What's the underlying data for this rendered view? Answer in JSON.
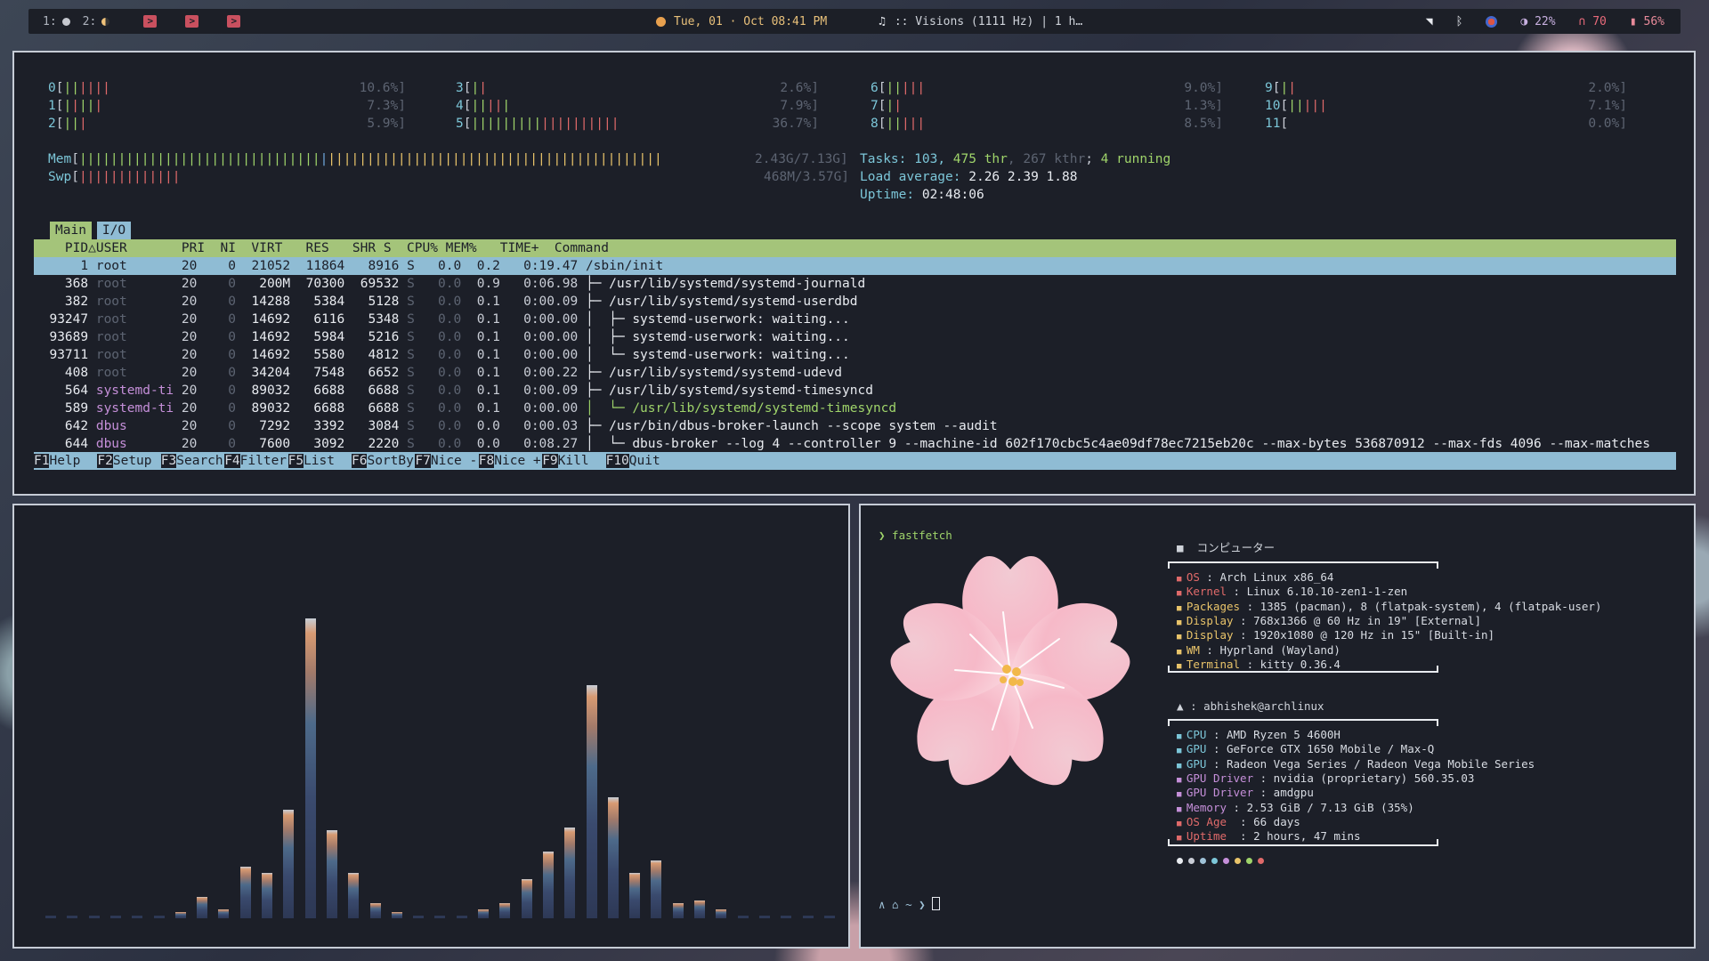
{
  "topbar": {
    "workspaces": [
      "1:",
      "2:"
    ],
    "datetime": "Tue, 01 · Oct  08:41 PM",
    "media": ":: Visions (1111 Hz) | 1 h…",
    "brightness": "22%",
    "volume": "70",
    "battery": "56%"
  },
  "htop": {
    "cpus_left": [
      {
        "id": "0",
        "pct": "10.6%]"
      },
      {
        "id": "1",
        "pct": "7.3%]"
      },
      {
        "id": "2",
        "pct": "5.9%]"
      }
    ],
    "cpus_mid": [
      {
        "id": "3",
        "pct": "2.6%]"
      },
      {
        "id": "4",
        "pct": "7.9%]"
      },
      {
        "id": "5",
        "pct": "36.7%]"
      }
    ],
    "cpus_r1": [
      {
        "id": "6",
        "pct": "9.0%]"
      },
      {
        "id": "7",
        "pct": "1.3%]"
      },
      {
        "id": "8",
        "pct": "8.5%]"
      }
    ],
    "cpus_r2": [
      {
        "id": "9",
        "pct": "2.0%]"
      },
      {
        "id": "10",
        "pct": "7.1%]"
      },
      {
        "id": "11",
        "pct": "0.0%]"
      }
    ],
    "mem_label": "Mem",
    "mem_value": "2.43G/7.13G]",
    "swp_label": "Swp",
    "swp_value": "468M/3.57G]",
    "tasks_label": "Tasks:",
    "tasks_count": "103,",
    "thr_count": "475 thr",
    "kthr": ", 267 kthr",
    "running": "4 running",
    "load_label": "Load average:",
    "load_values": "2.26 2.39 1.88",
    "uptime_label": "Uptime:",
    "uptime_value": "02:48:06",
    "tabs": [
      "Main",
      "I/O"
    ],
    "header": "    PID△USER       PRI  NI  VIRT   RES   SHR S  CPU% MEM%   TIME+  Command",
    "rows": [
      {
        "pid": "      1",
        "user": "root      ",
        "pri": "20",
        "ni": "   0",
        "virt": " 21052",
        "res": " 11864",
        "shr": "  8916",
        "s": "S",
        "cpu": "  0.0",
        "mem": " 0.2",
        "time": "  0:19.47",
        "cmd": "/sbin/init"
      },
      {
        "pid": "    368",
        "user": "root      ",
        "pri": "20",
        "ni": "   0",
        "virt": "  200M",
        "res": " 70300",
        "shr": " 69532",
        "s": "S",
        "cpu": "  0.0",
        "mem": " 0.9",
        "time": "  0:06.98",
        "cmd": "├─ /usr/lib/systemd/systemd-journald"
      },
      {
        "pid": "    382",
        "user": "root      ",
        "pri": "20",
        "ni": "   0",
        "virt": " 14288",
        "res": "  5384",
        "shr": "  5128",
        "s": "S",
        "cpu": "  0.0",
        "mem": " 0.1",
        "time": "  0:00.09",
        "cmd": "├─ /usr/lib/systemd/systemd-userdbd"
      },
      {
        "pid": "  93247",
        "user": "root      ",
        "pri": "20",
        "ni": "   0",
        "virt": " 14692",
        "res": "  6116",
        "shr": "  5348",
        "s": "S",
        "cpu": "  0.0",
        "mem": " 0.1",
        "time": "  0:00.00",
        "cmd": "│  ├─ systemd-userwork: waiting..."
      },
      {
        "pid": "  93689",
        "user": "root      ",
        "pri": "20",
        "ni": "   0",
        "virt": " 14692",
        "res": "  5984",
        "shr": "  5216",
        "s": "S",
        "cpu": "  0.0",
        "mem": " 0.1",
        "time": "  0:00.00",
        "cmd": "│  ├─ systemd-userwork: waiting..."
      },
      {
        "pid": "  93711",
        "user": "root      ",
        "pri": "20",
        "ni": "   0",
        "virt": " 14692",
        "res": "  5580",
        "shr": "  4812",
        "s": "S",
        "cpu": "  0.0",
        "mem": " 0.1",
        "time": "  0:00.00",
        "cmd": "│  └─ systemd-userwork: waiting..."
      },
      {
        "pid": "    408",
        "user": "root      ",
        "pri": "20",
        "ni": "   0",
        "virt": " 34204",
        "res": "  7548",
        "shr": "  6652",
        "s": "S",
        "cpu": "  0.0",
        "mem": " 0.1",
        "time": "  0:00.22",
        "cmd": "├─ /usr/lib/systemd/systemd-udevd"
      },
      {
        "pid": "    564",
        "user": "systemd-ti",
        "pri": "20",
        "ni": "   0",
        "virt": " 89032",
        "res": "  6688",
        "shr": "  6688",
        "s": "S",
        "cpu": "  0.0",
        "mem": " 0.1",
        "time": "  0:00.09",
        "cmd": "├─ /usr/lib/systemd/systemd-timesyncd"
      },
      {
        "pid": "    589",
        "user": "systemd-ti",
        "pri": "20",
        "ni": "   0",
        "virt": " 89032",
        "res": "  6688",
        "shr": "  6688",
        "s": "S",
        "cpu": "  0.0",
        "mem": " 0.1",
        "time": "  0:00.00",
        "cmd": "│  └─ /usr/lib/systemd/systemd-timesyncd"
      },
      {
        "pid": "    642",
        "user": "dbus      ",
        "pri": "20",
        "ni": "   0",
        "virt": "  7292",
        "res": "  3392",
        "shr": "  3084",
        "s": "S",
        "cpu": "  0.0",
        "mem": " 0.0",
        "time": "  0:00.03",
        "cmd": "├─ /usr/bin/dbus-broker-launch --scope system --audit"
      },
      {
        "pid": "    644",
        "user": "dbus      ",
        "pri": "20",
        "ni": "   0",
        "virt": "  7600",
        "res": "  3092",
        "shr": "  2220",
        "s": "S",
        "cpu": "  0.0",
        "mem": " 0.0",
        "time": "  0:08.27",
        "cmd": "│  └─ dbus-broker --log 4 --controller 9 --machine-id 602f170cbc5c4ae09df78ec7215eb20c --max-bytes 536870912 --max-fds 4096 --max-matches"
      }
    ],
    "fkeys": [
      {
        "k": "F1",
        "v": "Help  "
      },
      {
        "k": "F2",
        "v": "Setup "
      },
      {
        "k": "F3",
        "v": "Search"
      },
      {
        "k": "F4",
        "v": "Filter"
      },
      {
        "k": "F5",
        "v": "List  "
      },
      {
        "k": "F6",
        "v": "SortBy"
      },
      {
        "k": "F7",
        "v": "Nice -"
      },
      {
        "k": "F8",
        "v": "Nice +"
      },
      {
        "k": "F9",
        "v": "Kill  "
      },
      {
        "k": "F10",
        "v": "Quit"
      }
    ]
  },
  "cava": {
    "bars": [
      0.01,
      0.01,
      0.01,
      0.01,
      0.01,
      0.01,
      0.02,
      0.07,
      0.03,
      0.17,
      0.15,
      0.36,
      0.99,
      0.29,
      0.15,
      0.05,
      0.02,
      0.01,
      0.01,
      0.01,
      0.03,
      0.05,
      0.13,
      0.22,
      0.3,
      0.77,
      0.4,
      0.15,
      0.19,
      0.05,
      0.06,
      0.03,
      0.01,
      0.01,
      0.01,
      0.01,
      0.01
    ]
  },
  "fastfetch": {
    "prompt_cmd": "❯ fastfetch",
    "host_title": "コンピューター",
    "sys": [
      {
        "k": "OS",
        "v": " : Arch Linux x86_64",
        "c": "#e06a6a"
      },
      {
        "k": "Kernel",
        "v": " : Linux 6.10.10-zen1-1-zen",
        "c": "#e06a6a"
      },
      {
        "k": "Packages",
        "v": " : 1385 (pacman), 8 (flatpak-system), 4 (flatpak-user)",
        "c": "#e9c46a"
      },
      {
        "k": "Display",
        "v": " : 768x1366 @ 60 Hz in 19\" [External]",
        "c": "#e9c46a"
      },
      {
        "k": "Display",
        "v": " : 1920x1080 @ 120 Hz in 15\" [Built-in]",
        "c": "#e9c46a"
      },
      {
        "k": "WM",
        "v": " : Hyprland (Wayland)",
        "c": "#e9c46a"
      },
      {
        "k": "Terminal",
        "v": " : kitty 0.36.4",
        "c": "#e9c46a"
      }
    ],
    "user": ": abhishek@archlinux",
    "hw": [
      {
        "k": "CPU",
        "v": " : AMD Ryzen 5 4600H",
        "c": "#7cc6d8"
      },
      {
        "k": "GPU",
        "v": " : GeForce GTX 1650 Mobile / Max-Q",
        "c": "#7cc6d8"
      },
      {
        "k": "GPU",
        "v": " : Radeon Vega Series / Radeon Vega Mobile Series",
        "c": "#7cc6d8"
      },
      {
        "k": "GPU Driver",
        "v": " : nvidia (proprietary) 560.35.03",
        "c": "#c58fd9"
      },
      {
        "k": "GPU Driver",
        "v": " : amdgpu",
        "c": "#c58fd9"
      },
      {
        "k": "Memory",
        "v": " : 2.53 GiB / 7.13 GiB (35%)",
        "c": "#c58fd9"
      },
      {
        "k": "OS Age ",
        "v": " : 66 days",
        "c": "#e06a6a"
      },
      {
        "k": "Uptime ",
        "v": " : 2 hours, 47 mins",
        "c": "#e06a6a"
      }
    ],
    "palette": [
      "#e8ebf0",
      "#c9cdd6",
      "#9fc2d8",
      "#7cc6d8",
      "#c58fd9",
      "#e9c46a",
      "#9fd46a",
      "#e06a6a"
    ],
    "prompt2": "∧ ⌂ ~ ❯"
  }
}
